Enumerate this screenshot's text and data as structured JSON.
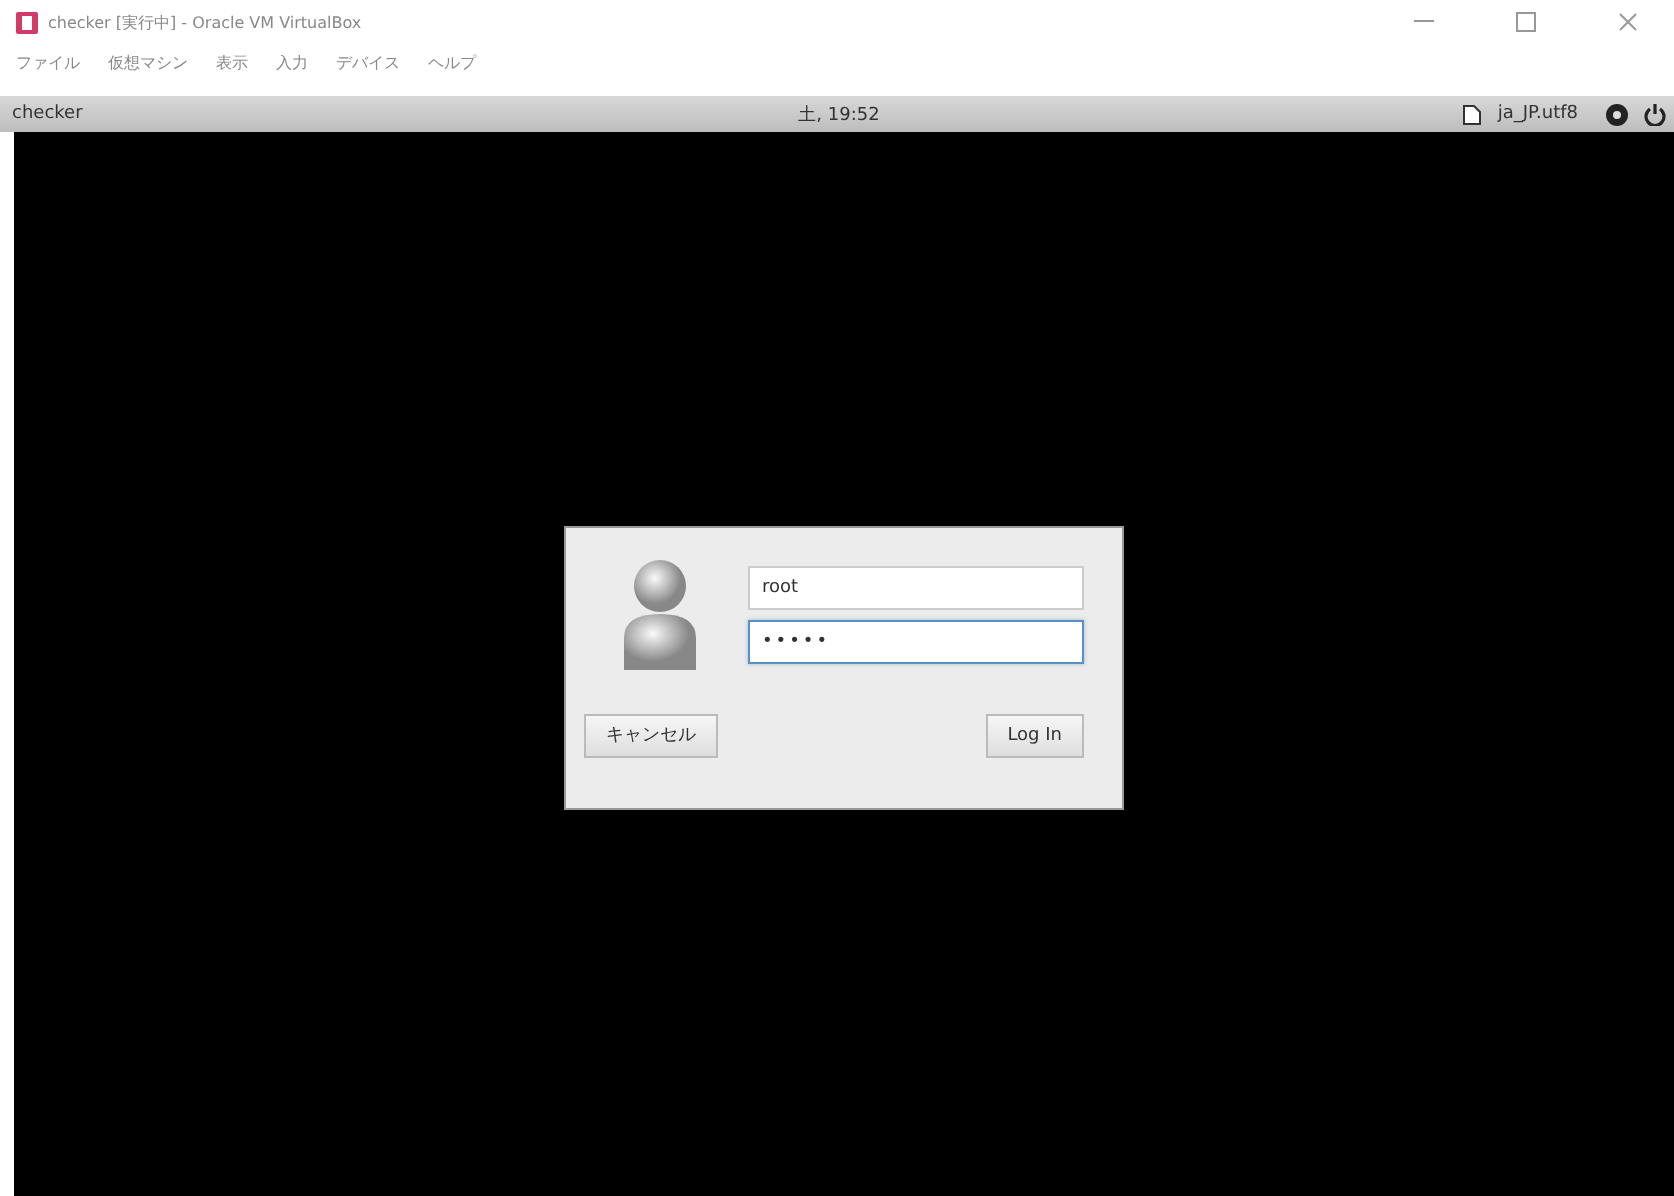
{
  "window": {
    "title": "checker [実行中] - Oracle VM VirtualBox"
  },
  "menu": [
    "ファイル",
    "仮想マシン",
    "表示",
    "入力",
    "デバイス",
    "ヘルプ"
  ],
  "top_panel": {
    "host": "checker",
    "clock": "土, 19:52",
    "locale": "ja_JP.utf8"
  },
  "login": {
    "fields": [
      {
        "kind": "username",
        "value": "root",
        "focused": false
      },
      {
        "kind": "password",
        "value": "•••••",
        "focused": true
      }
    ],
    "buttons": [
      {
        "label": "キャンセル",
        "kind": "cancel"
      },
      {
        "label": "Log In",
        "kind": "login"
      }
    ]
  }
}
